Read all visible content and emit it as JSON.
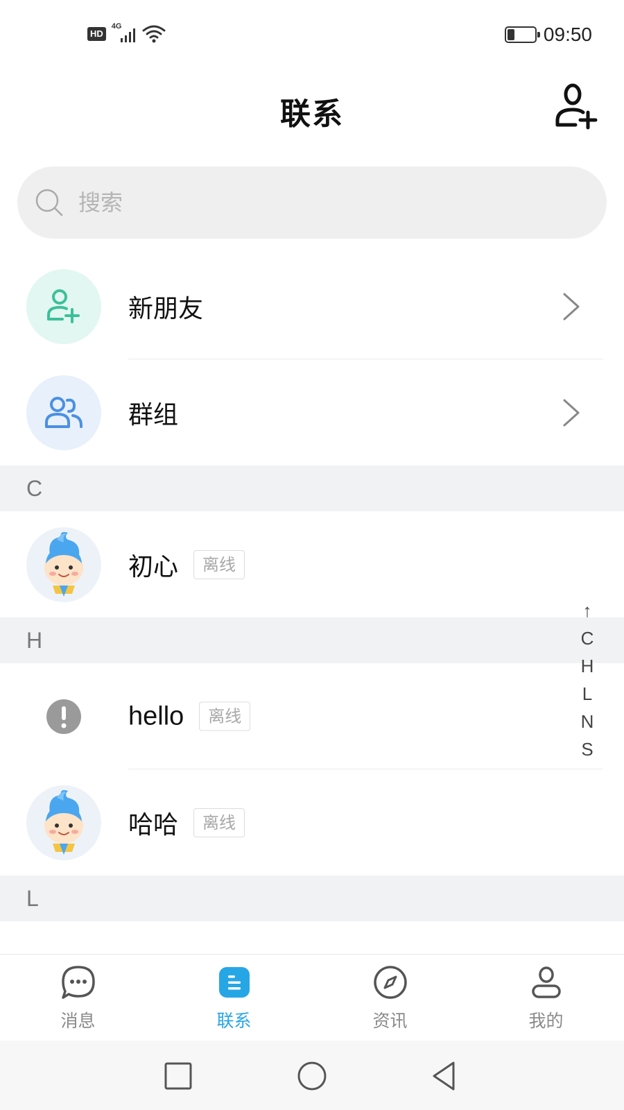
{
  "status_bar": {
    "hd_badge": "HD",
    "network": "4G",
    "time": "09:50",
    "battery_level": 0.25
  },
  "header": {
    "title": "联系",
    "add_icon": "add-person-icon"
  },
  "search": {
    "placeholder": "搜索",
    "icon": "search-icon"
  },
  "shortcuts": [
    {
      "label": "新朋友",
      "icon": "add-person-icon"
    },
    {
      "label": "群组",
      "icon": "group-icon"
    }
  ],
  "sections": [
    {
      "letter": "C",
      "contacts": [
        {
          "name": "初心",
          "status": "离线",
          "avatar": "cartoon-baby-avatar"
        }
      ]
    },
    {
      "letter": "H",
      "contacts": [
        {
          "name": "hello",
          "status": "离线",
          "avatar": "alert-icon"
        },
        {
          "name": "哈哈",
          "status": "离线",
          "avatar": "cartoon-baby-avatar"
        }
      ]
    },
    {
      "letter": "L",
      "contacts": []
    }
  ],
  "alpha_index": [
    "↑",
    "C",
    "H",
    "L",
    "N",
    "S"
  ],
  "bottom_nav": [
    {
      "label": "消息",
      "icon": "chat-bubble-icon",
      "active": false
    },
    {
      "label": "联系",
      "icon": "contacts-icon",
      "active": true
    },
    {
      "label": "资讯",
      "icon": "compass-icon",
      "active": false
    },
    {
      "label": "我的",
      "icon": "person-icon",
      "active": false
    }
  ],
  "colors": {
    "accent": "#27a6e6",
    "new_friend_icon": "#3cc09a",
    "group_icon": "#4a90e2",
    "section_bg": "#f1f2f4"
  }
}
